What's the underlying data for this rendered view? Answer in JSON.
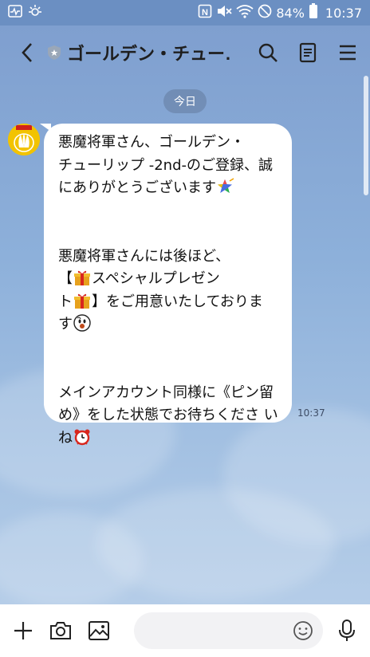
{
  "status_bar": {
    "battery": "84%",
    "time": "10:37"
  },
  "header": {
    "title": "ゴールデン・チュー…",
    "icons": [
      "back-icon",
      "shield-icon",
      "search-icon",
      "notes-icon",
      "menu-icon"
    ]
  },
  "date_label": "今日",
  "message": {
    "lines": [
      "悪魔将軍さん、ゴールデン・",
      "チューリップ -2nd-のご登録、誠",
      "にありがとうございます",
      "",
      "",
      "悪魔将軍さんには後ほど、",
      "【",
      "スペシャルプレゼン",
      "ト",
      "】をご用意いたしておりま",
      "す",
      "",
      "",
      "メインアカウント同様に《ピン留",
      "め》をした状態でお待ちくださ い",
      "ね"
    ],
    "time": "10:37"
  },
  "input_bar": {
    "placeholder": "",
    "icons": [
      "plus-icon",
      "camera-icon",
      "image-icon",
      "sticker-icon",
      "mic-icon"
    ]
  },
  "colors": {
    "background": "#8aacd6",
    "bubble": "#ffffff",
    "status_bar": "#6b8fc2"
  }
}
